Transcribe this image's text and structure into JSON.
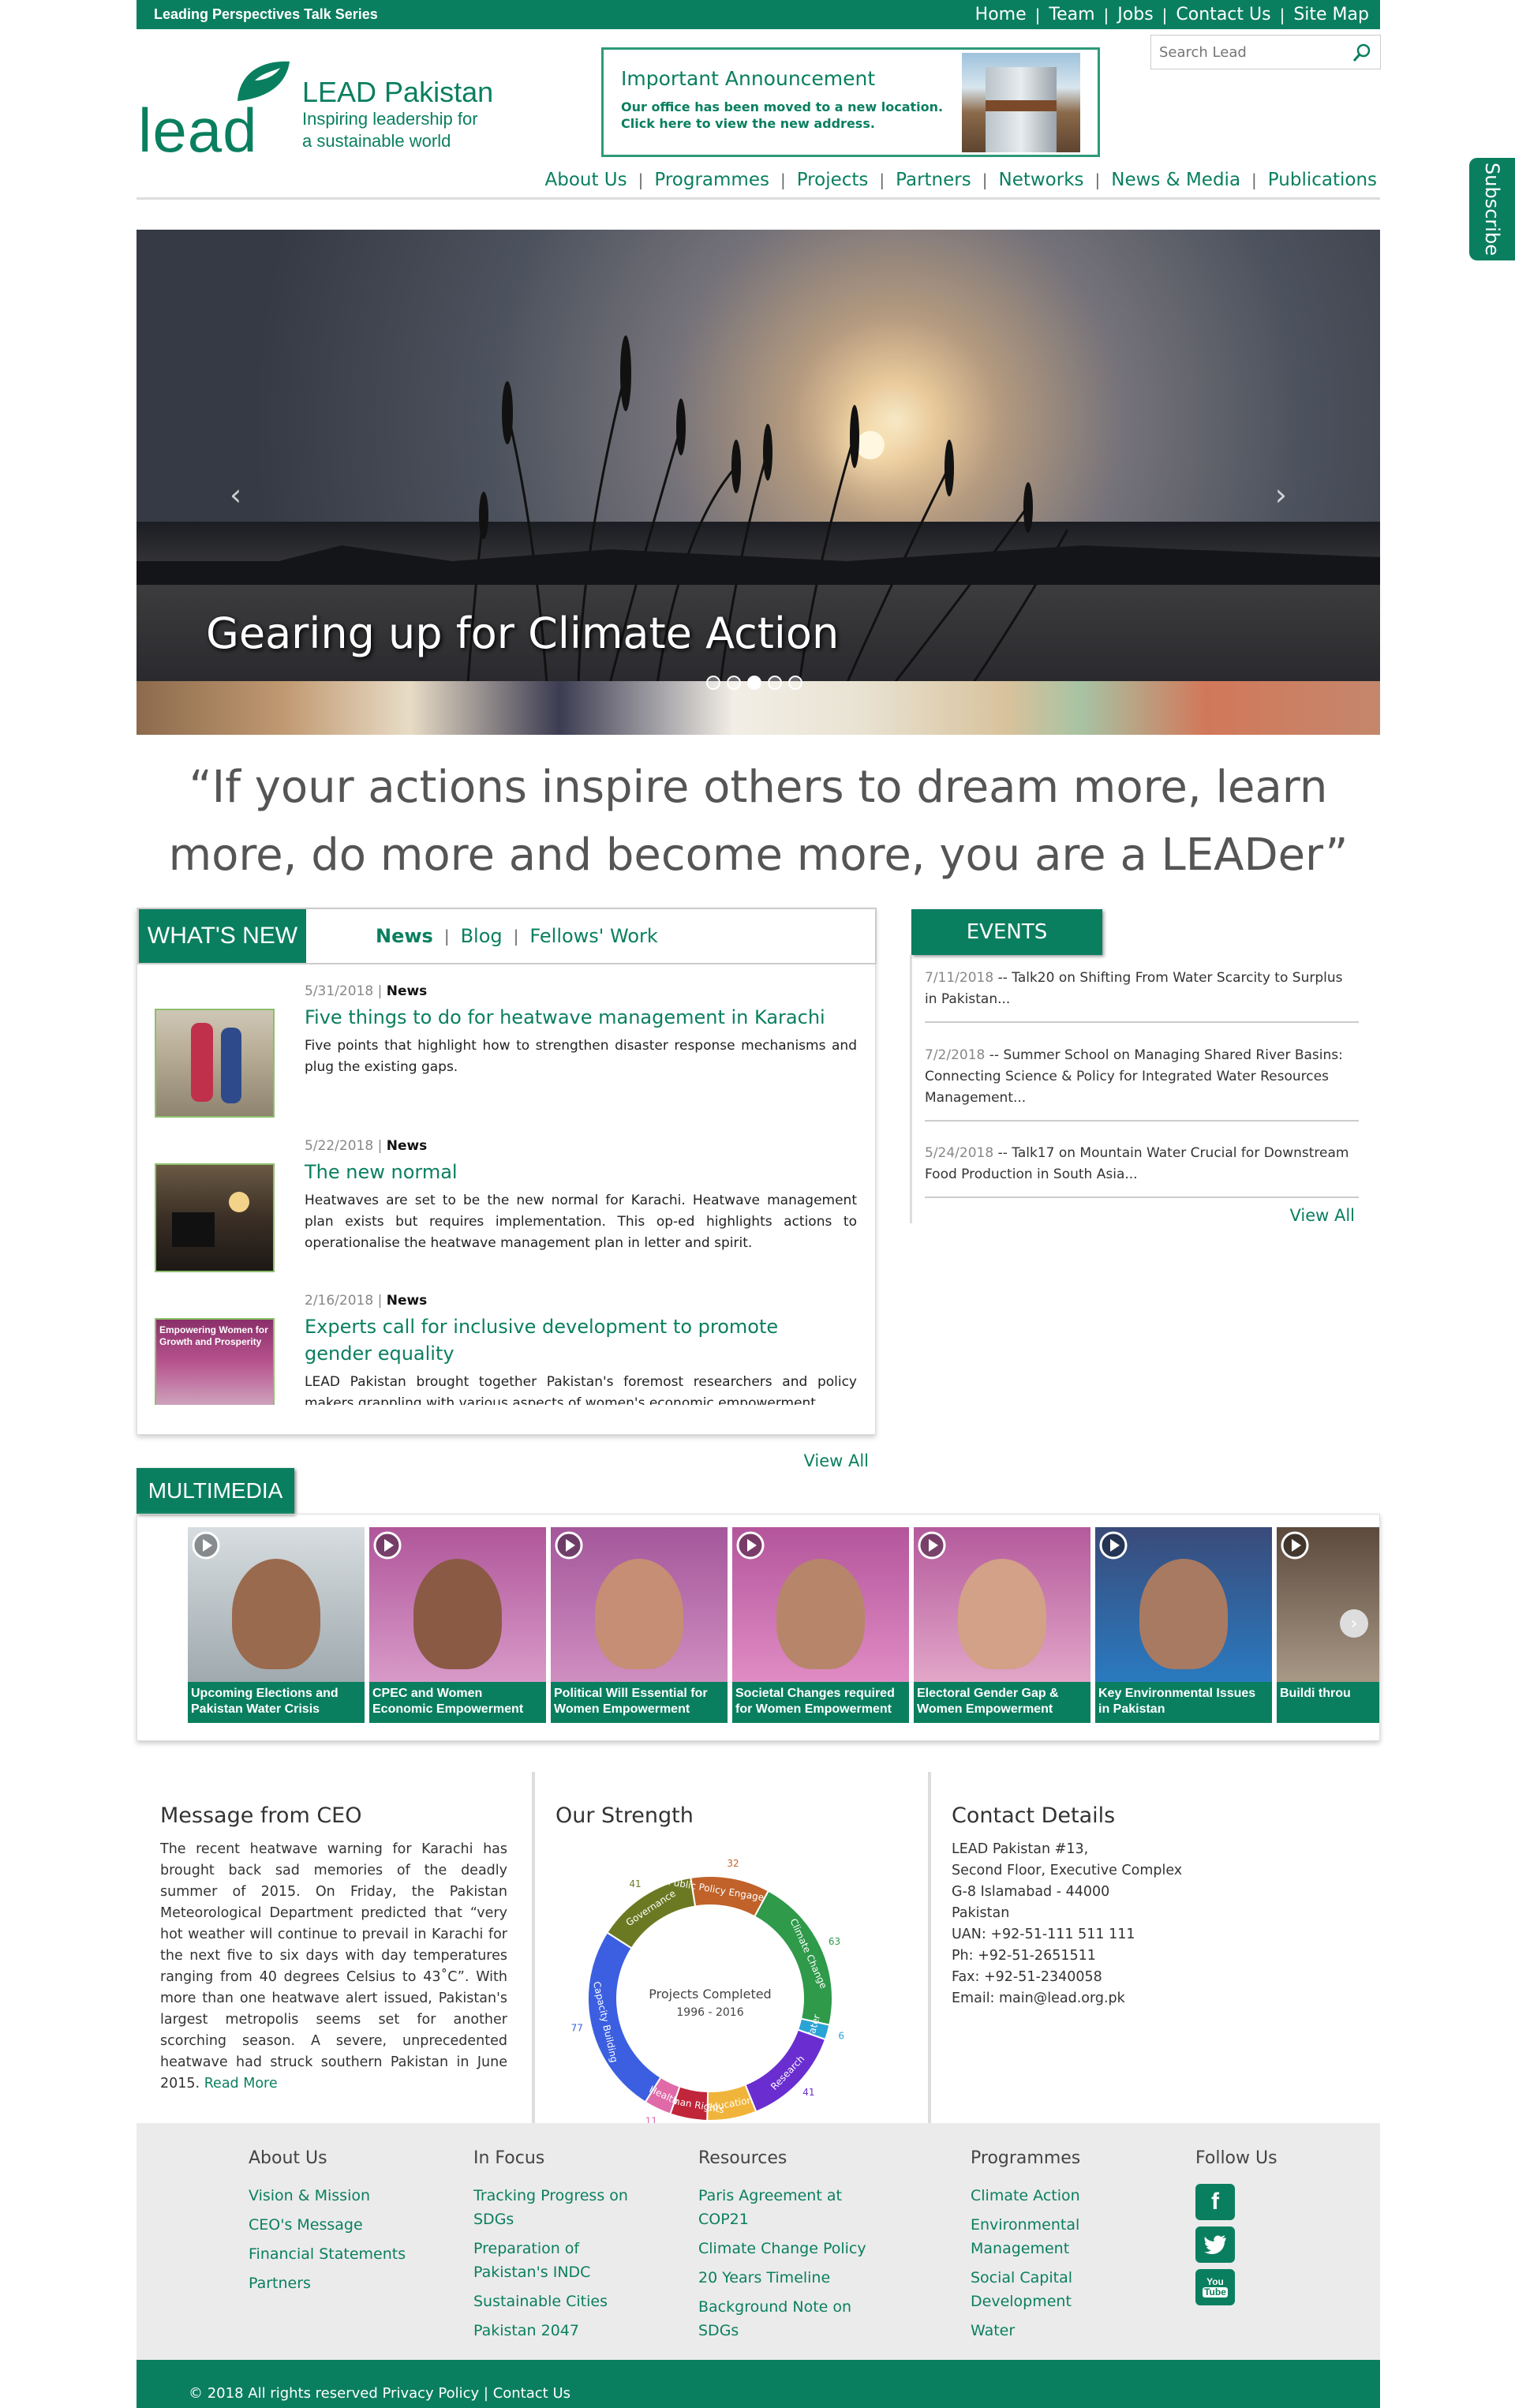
{
  "topbar": {
    "series": "Leading Perspectives Talk Series",
    "links": [
      "Home",
      "Team",
      "Jobs",
      "Contact Us",
      "Site Map"
    ]
  },
  "logo": {
    "wordmark": "lead",
    "org": "LEAD Pakistan",
    "tagline_1": "Inspiring leadership for",
    "tagline_2": "a sustainable world"
  },
  "announcement": {
    "title": "Important Announcement",
    "body": "Our office has been moved to a new location. Click here to view the new address."
  },
  "search": {
    "placeholder": "Search Lead"
  },
  "nav": [
    "About Us",
    "Programmes",
    "Projects",
    "Partners",
    "Networks",
    "News & Media",
    "Publications"
  ],
  "subscribe": "Subscribe",
  "hero": {
    "caption": "Gearing up for Climate Action",
    "slides": 5,
    "active_slide": 3
  },
  "quote": {
    "line1": "“If your actions inspire others to dream more, learn",
    "line2": "more, do more and become more, you are a LEADer”"
  },
  "whats_new": {
    "label": "WHAT'S NEW",
    "tabs": [
      "News",
      "Blog",
      "Fellows' Work"
    ],
    "items": [
      {
        "date": "5/31/2018",
        "category": "News",
        "title": "Five things to do for heatwave management in Karachi",
        "desc": "Five points that highlight how to strengthen disaster response mechanisms and plug the existing gaps."
      },
      {
        "date": "5/22/2018",
        "category": "News",
        "title": "The new normal",
        "desc": "Heatwaves are set to be the new normal for Karachi. Heatwave management plan exists but requires implementation. This op-ed highlights actions to operationalise the heatwave management plan in letter and spirit."
      },
      {
        "date": "2/16/2018",
        "category": "News",
        "title": "Experts call for inclusive development to promote gender equality",
        "desc": "LEAD Pakistan brought together Pakistan's foremost researchers and policy makers grappling with various aspects of women's economic empowerment."
      }
    ],
    "thumb3_text": "Empowering Women for Growth and Prosperity",
    "view_all": "View All"
  },
  "events": {
    "label": "EVENTS",
    "items": [
      {
        "date": "7/11/2018",
        "title": "Talk20 on Shifting From Water Scarcity to Surplus in Pakistan..."
      },
      {
        "date": "7/2/2018",
        "title": "Summer School on Managing Shared River Basins: Connecting Science & Policy for Integrated Water Resources Management..."
      },
      {
        "date": "5/24/2018",
        "title": "Talk17 on Mountain Water Crucial for Downstream Food Production in South Asia..."
      }
    ],
    "view_all": "View All"
  },
  "multimedia": {
    "label": "MULTIMEDIA",
    "cards": [
      {
        "caption": "Upcoming Elections and Pakistan Water Crisis"
      },
      {
        "caption": "CPEC and Women Economic Empowerment"
      },
      {
        "caption": "Political Will Essential for Women Empowerment"
      },
      {
        "caption": "Societal Changes required for Women Empowerment"
      },
      {
        "caption": "Electoral Gender Gap & Women Empowerment"
      },
      {
        "caption": "Key Environmental Issues in Pakistan"
      },
      {
        "caption": "Buildi throu"
      }
    ]
  },
  "ceo": {
    "title": "Message from CEO",
    "text": "The recent heatwave warning for Karachi has brought back sad memories of the deadly summer of 2015. On Friday, the Pakistan Meteorological Department predicted that “very hot weather will continue to prevail in Karachi for the next five to six days with day temperatures ranging from 40 degrees Celsius to 43˚C”. With more than one heatwave alert issued, Pakistan's largest metropolis seems set for another scorching season. A severe, unprecedented heatwave had struck southern Pakistan in June 2015.",
    "read_more": "Read More"
  },
  "strength": {
    "title": "Our Strength",
    "center_1": "Projects Completed",
    "center_2": "1996 - 2016",
    "colors": [
      "#3b5fe0",
      "#6b7a22",
      "#c0622a",
      "#2e9a4a",
      "#2aa3d6",
      "#6a2ed0",
      "#f0b43a",
      "#c0253a",
      "#e06aa8"
    ]
  },
  "chart_data": {
    "type": "pie",
    "title": "Projects Completed 1996 - 2016",
    "categories": [
      "Capacity Building",
      "Governance",
      "Public Policy Engagement",
      "Climate Change",
      "Water",
      "Research",
      "Education",
      "Human Rights",
      "Health"
    ],
    "values": [
      77,
      41,
      32,
      63,
      6,
      41,
      20,
      15,
      11
    ]
  },
  "contact": {
    "title": "Contact Details",
    "lines": [
      "LEAD Pakistan #13,",
      "Second Floor, Executive Complex",
      "G-8 Islamabad - 44000",
      "Pakistan",
      "UAN: +92-51-111 511 111",
      "Ph: +92-51-2651511",
      "Fax: +92-51-2340058",
      "Email: main@lead.org.pk"
    ]
  },
  "footer": {
    "about": {
      "heading": "About Us",
      "links": [
        "Vision & Mission",
        "CEO's Message",
        "Financial Statements",
        "Partners"
      ]
    },
    "focus": {
      "heading": "In Focus",
      "links": [
        "Tracking Progress on SDGs",
        "Preparation of Pakistan's INDC",
        "Sustainable Cities",
        "Pakistan 2047"
      ]
    },
    "resources": {
      "heading": "Resources",
      "links": [
        "Paris Agreement at COP21",
        "Climate Change Policy",
        "20 Years Timeline",
        "Background Note on SDGs"
      ]
    },
    "programmes": {
      "heading": "Programmes",
      "links": [
        "Climate Action",
        "Environmental Management",
        "Social Capital Development",
        "Water"
      ]
    },
    "follow": {
      "heading": "Follow Us",
      "icons": [
        "facebook-icon",
        "twitter-icon",
        "youtube-icon"
      ],
      "youtube_you": "You",
      "youtube_tube": "Tube"
    },
    "copyright": "© 2018 All rights reserved",
    "privacy": "Privacy Policy",
    "contact": "Contact Us"
  }
}
